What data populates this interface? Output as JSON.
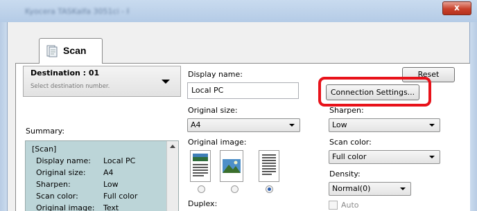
{
  "window": {
    "title": "Kyocera TASKalfa 3051ci - PanelTool",
    "close_glyph": "x"
  },
  "tab": {
    "label": "Scan",
    "icon": "scanner-document-icon"
  },
  "destination": {
    "title": "Destination : 01",
    "hint": "Select destination number."
  },
  "summary": {
    "label": "Summary:",
    "header": "[Scan]",
    "rows": [
      {
        "key": "Display name:",
        "value": "Local PC"
      },
      {
        "key": "Original size:",
        "value": "A4"
      },
      {
        "key": "Sharpen:",
        "value": "Low"
      },
      {
        "key": "Scan color:",
        "value": "Full color"
      },
      {
        "key": "Original image:",
        "value": "Text"
      }
    ]
  },
  "form": {
    "display_name_label": "Display name:",
    "display_name_value": "Local PC",
    "original_size_label": "Original size:",
    "original_size_value": "A4",
    "original_image_label": "Original image:",
    "original_image_options": [
      "text-photo-icon",
      "photo-icon",
      "text-icon"
    ],
    "original_image_selected": 2,
    "duplex_label": "Duplex:"
  },
  "right": {
    "reset_label": "Reset",
    "connection_settings_label": "Connection Settings...",
    "sharpen_label": "Sharpen:",
    "sharpen_value": "Low",
    "scan_color_label": "Scan color:",
    "scan_color_value": "Full color",
    "density_label": "Density:",
    "density_value": "Normal(0)",
    "auto_label": "Auto",
    "auto_checked": false
  },
  "colors": {
    "highlight": "#e8121a",
    "summary_bg": "#bcd5d8",
    "title_bar": "#b4cbe6"
  }
}
